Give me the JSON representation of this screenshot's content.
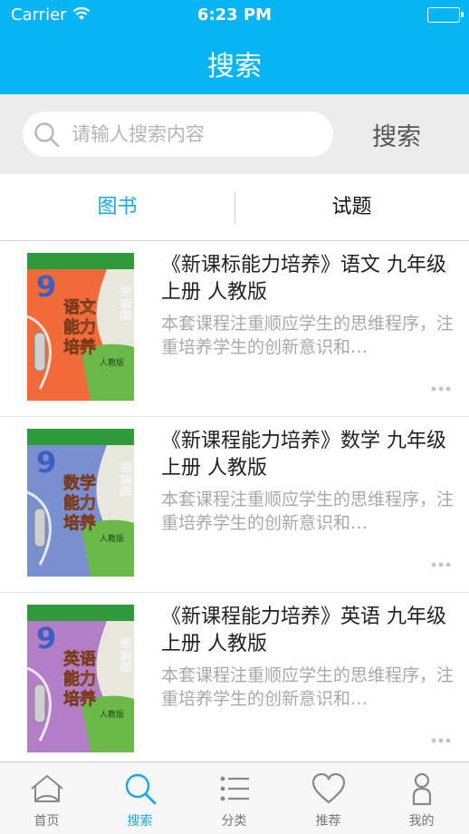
{
  "status_bar": {
    "carrier": "Carrier",
    "time": "6:23 PM"
  },
  "nav": {
    "title": "搜索"
  },
  "search": {
    "placeholder": "请输人搜索内容",
    "button_label": "搜索"
  },
  "tabs": [
    {
      "label": "图书",
      "active": true
    },
    {
      "label": "试题",
      "active": false
    }
  ],
  "books": [
    {
      "title": "《新课标能力培养》语文 九年级 上册 人教版",
      "description": "本套课程注重顺应学生的思维程序，注重培养学生的创新意识和…",
      "cover": {
        "number": "9",
        "subject": "语文\n能力\n培养",
        "series": "新课程",
        "edition": "人教版",
        "color": "#f06a3a"
      }
    },
    {
      "title": "《新课程能力培养》数学 九年级 上册 人教版",
      "description": "本套课程注重顺应学生的思维程序，注重培养学生的创新意识和…",
      "cover": {
        "number": "9",
        "subject": "数学\n能力\n培养",
        "series": "新课程",
        "edition": "人教版",
        "color": "#7a8fd0"
      }
    },
    {
      "title": "《新课程能力培养》英语 九年级 上册 人教版",
      "description": "本套课程注重顺应学生的思维程序，注重培养学生的创新意识和…",
      "cover": {
        "number": "9",
        "subject": "英语\n能力\n培养",
        "series": "新课程",
        "edition": "人教版",
        "color": "#b27fc6"
      }
    }
  ],
  "tabbar": [
    {
      "label": "首页",
      "icon": "home-icon",
      "active": false
    },
    {
      "label": "搜索",
      "icon": "search-icon",
      "active": true
    },
    {
      "label": "分类",
      "icon": "list-icon",
      "active": false
    },
    {
      "label": "推荐",
      "icon": "heart-icon",
      "active": false
    },
    {
      "label": "我的",
      "icon": "person-icon",
      "active": false
    }
  ],
  "colors": {
    "accent": "#08b5f4",
    "active_text": "#1aa7e6",
    "description": "#a8a8a8"
  }
}
